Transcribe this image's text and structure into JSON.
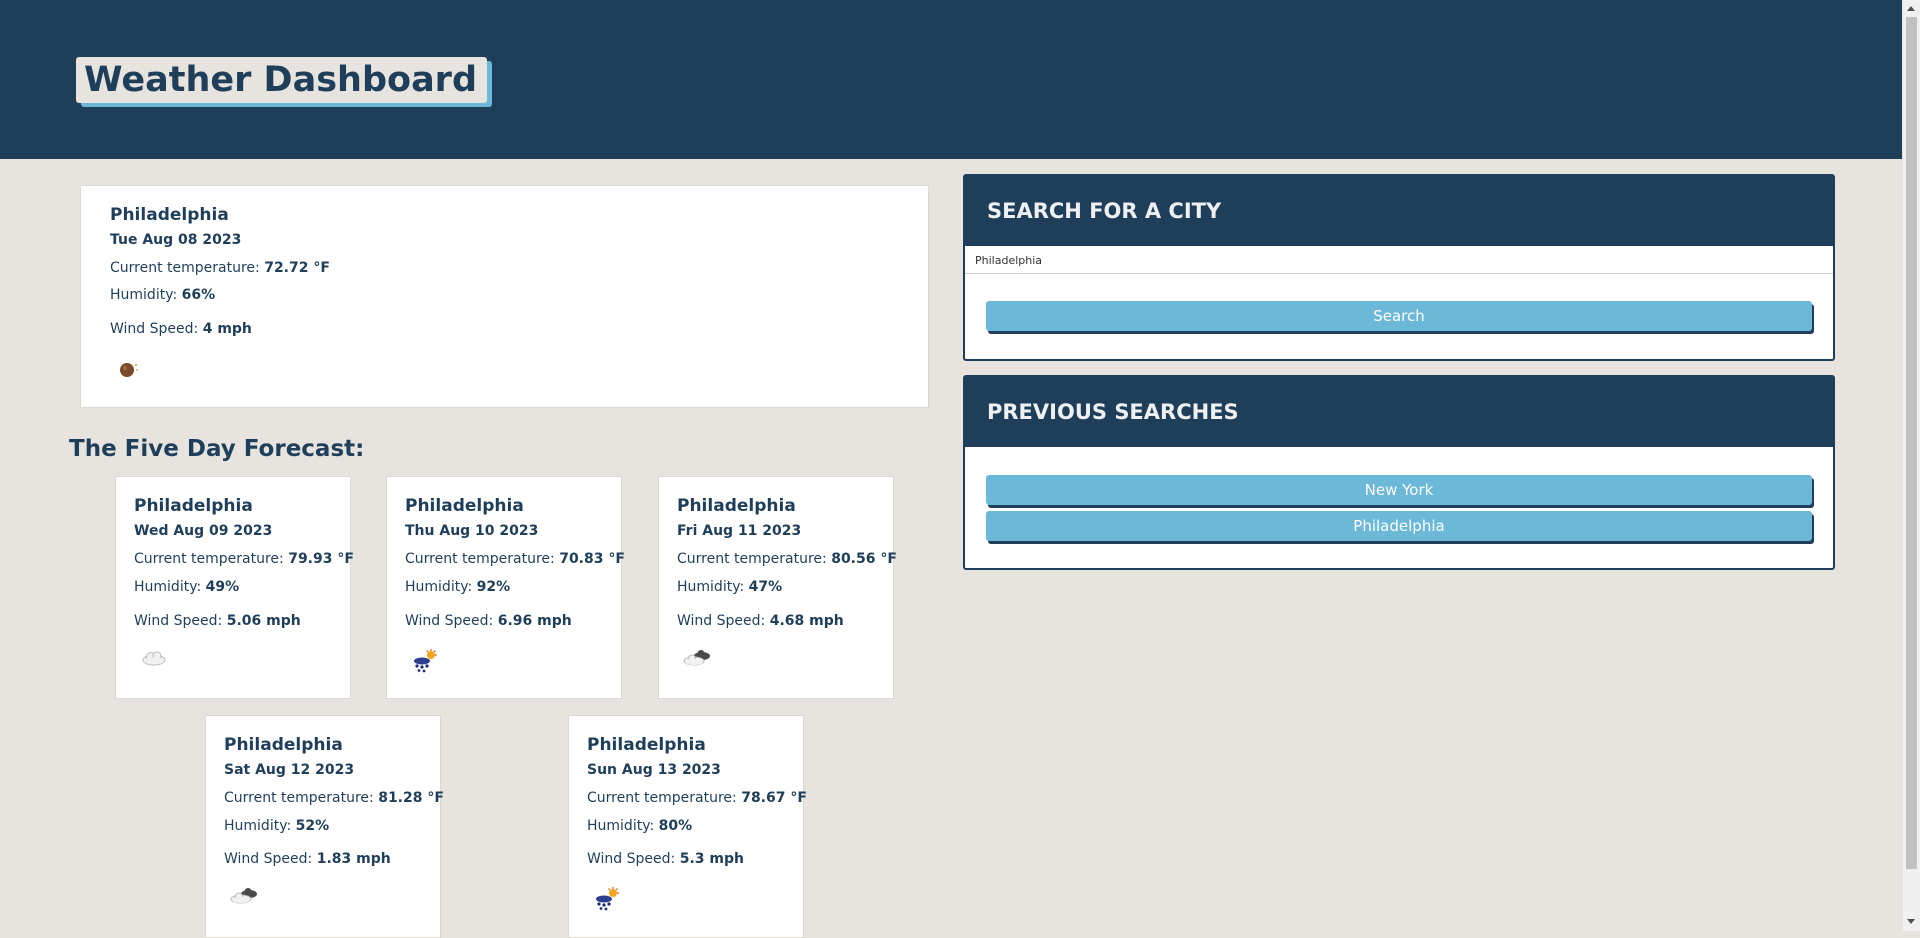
{
  "header": {
    "title": "Weather Dashboard"
  },
  "current": {
    "city": "Philadelphia",
    "date": "Tue Aug 08 2023",
    "temp_label": "Current temperature: ",
    "temp_value": "72.72 °F",
    "humidity_label": "Humidity: ",
    "humidity_value": "66%",
    "wind_label": "Wind Speed: ",
    "wind_value": "4 mph",
    "icon": "moon-icon"
  },
  "forecast": {
    "heading": "The Five Day Forecast:",
    "days": [
      {
        "city": "Philadelphia",
        "date": "Wed Aug 09 2023",
        "temp_label": "Current temperature: ",
        "temp_value": "79.93 °F",
        "humidity_label": "Humidity: ",
        "humidity_value": "49%",
        "wind_label": "Wind Speed: ",
        "wind_value": "5.06 mph",
        "icon": "cloud-icon"
      },
      {
        "city": "Philadelphia",
        "date": "Thu Aug 10 2023",
        "temp_label": "Current temperature: ",
        "temp_value": "70.83 °F",
        "humidity_label": "Humidity: ",
        "humidity_value": "92%",
        "wind_label": "Wind Speed: ",
        "wind_value": "6.96 mph",
        "icon": "rain-sun-icon"
      },
      {
        "city": "Philadelphia",
        "date": "Fri Aug 11 2023",
        "temp_label": "Current temperature: ",
        "temp_value": "80.56 °F",
        "humidity_label": "Humidity: ",
        "humidity_value": "47%",
        "wind_label": "Wind Speed: ",
        "wind_value": "4.68 mph",
        "icon": "broken-clouds-icon"
      },
      {
        "city": "Philadelphia",
        "date": "Sat Aug 12 2023",
        "temp_label": "Current temperature: ",
        "temp_value": "81.28 °F",
        "humidity_label": "Humidity: ",
        "humidity_value": "52%",
        "wind_label": "Wind Speed: ",
        "wind_value": "1.83 mph",
        "icon": "broken-clouds-icon"
      },
      {
        "city": "Philadelphia",
        "date": "Sun Aug 13 2023",
        "temp_label": "Current temperature: ",
        "temp_value": "78.67 °F",
        "humidity_label": "Humidity: ",
        "humidity_value": "80%",
        "wind_label": "Wind Speed: ",
        "wind_value": "5.3 mph",
        "icon": "rain-sun-icon"
      }
    ]
  },
  "search": {
    "heading": "SEARCH FOR A CITY",
    "input_value": "Philadelphia",
    "button_label": "Search"
  },
  "previous": {
    "heading": "PREVIOUS SEARCHES",
    "items": [
      {
        "label": "New York"
      },
      {
        "label": "Philadelphia"
      }
    ]
  },
  "colors": {
    "navy": "#1f3e5a",
    "accent": "#6bb8d8",
    "background": "#e7e3df"
  }
}
